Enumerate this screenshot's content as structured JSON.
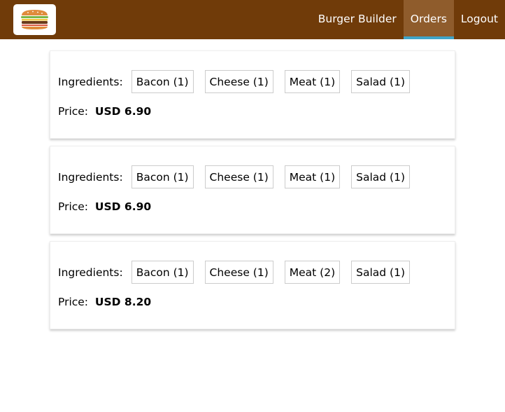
{
  "header": {
    "logo_icon": "burger-logo-icon",
    "nav": [
      {
        "label": "Burger Builder",
        "active": false
      },
      {
        "label": "Orders",
        "active": true
      },
      {
        "label": "Logout",
        "active": false
      }
    ]
  },
  "orders": [
    {
      "ingredients_label": "Ingredients:",
      "ingredients": [
        "Bacon (1)",
        "Cheese (1)",
        "Meat (1)",
        "Salad (1)"
      ],
      "price_label": "Price:",
      "price": "USD 6.90"
    },
    {
      "ingredients_label": "Ingredients:",
      "ingredients": [
        "Bacon (1)",
        "Cheese (1)",
        "Meat (1)",
        "Salad (1)"
      ],
      "price_label": "Price:",
      "price": "USD 6.90"
    },
    {
      "ingredients_label": "Ingredients:",
      "ingredients": [
        "Bacon (1)",
        "Cheese (1)",
        "Meat (2)",
        "Salad (1)"
      ],
      "price_label": "Price:",
      "price": "USD 8.20"
    }
  ],
  "colors": {
    "toolbar": "#703b09",
    "active_nav": "#8f5c2c",
    "active_underline": "#40a4c8"
  }
}
